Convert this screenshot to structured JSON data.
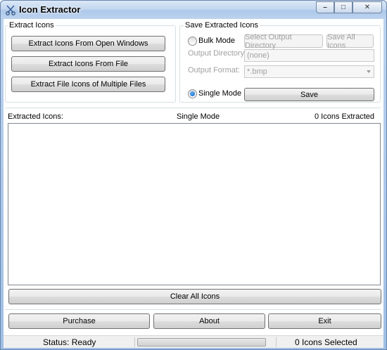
{
  "window": {
    "title": "Icon Extractor",
    "caption": {
      "minimize": "–",
      "maximize": "□",
      "close": "✕"
    }
  },
  "extract_group": {
    "label": "Extract Icons",
    "buttons": [
      "Extract Icons From Open Windows",
      "Extract Icons From File",
      "Extract File Icons of Multiple Files"
    ]
  },
  "save_group": {
    "label": "Save Extracted Icons",
    "bulk_mode": {
      "label": "Bulk Mode",
      "checked": false
    },
    "select_output_dir_button": "Select Output Directory",
    "save_all_icons_button": "Save All Icons",
    "output_directory": {
      "label": "Output Directory:",
      "value": "(none)"
    },
    "output_format": {
      "label": "Output Format:",
      "value": "*.bmp"
    },
    "single_mode": {
      "label": "Single Mode",
      "checked": true
    },
    "save_button": "Save"
  },
  "list_header": {
    "left": "Extracted Icons:",
    "center": "Single Mode",
    "right": "0 Icons Extracted"
  },
  "clear_all_button": "Clear All Icons",
  "footer_buttons": {
    "purchase": "Purchase",
    "about": "About",
    "exit": "Exit"
  },
  "status": {
    "left": "Status: Ready",
    "progress": 0,
    "right": "0 Icons Selected"
  },
  "icons": {
    "app": "scissors-icon",
    "minimize": "minimize-icon",
    "maximize": "maximize-icon",
    "close": "close-icon"
  }
}
